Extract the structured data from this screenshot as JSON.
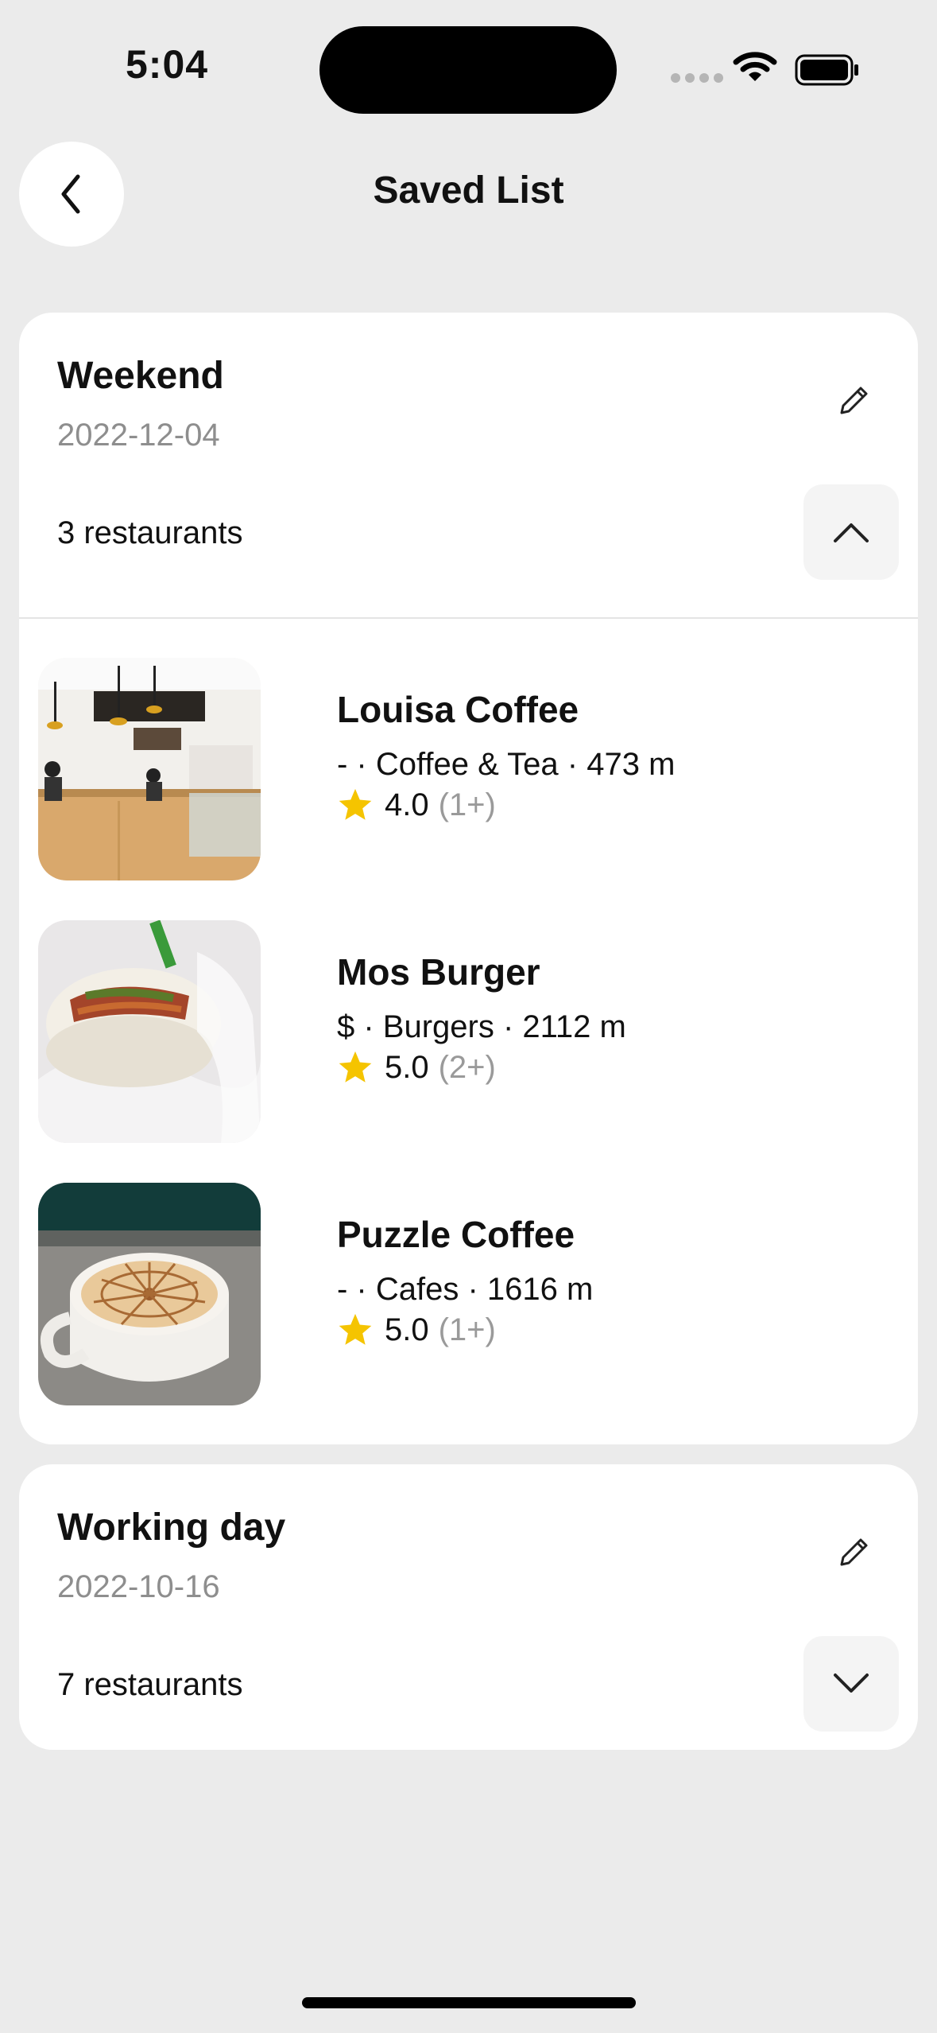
{
  "status": {
    "time": "5:04"
  },
  "header": {
    "title": "Saved List"
  },
  "lists": [
    {
      "name": "Weekend",
      "date": "2022-12-04",
      "count_label": "3 restaurants",
      "expanded": true,
      "restaurants": [
        {
          "name": "Louisa Coffee",
          "meta": "- · Coffee & Tea · 473 m",
          "rating": "4.0",
          "reviews": "(1+)"
        },
        {
          "name": "Mos Burger",
          "meta": "$ · Burgers · 2112 m",
          "rating": "5.0",
          "reviews": "(2+)"
        },
        {
          "name": "Puzzle Coffee",
          "meta": "- · Cafes · 1616 m",
          "rating": "5.0",
          "reviews": "(1+)"
        }
      ]
    },
    {
      "name": "Working day",
      "date": "2022-10-16",
      "count_label": "7 restaurants",
      "expanded": false
    }
  ],
  "colors": {
    "background": "#ebebeb",
    "card": "#ffffff",
    "star": "#f5c400",
    "muted": "#8e8e8e"
  },
  "icons": [
    "back-chevron-icon",
    "pencil-icon",
    "chevron-up-icon",
    "chevron-down-icon",
    "star-icon",
    "wifi-icon",
    "battery-icon"
  ]
}
